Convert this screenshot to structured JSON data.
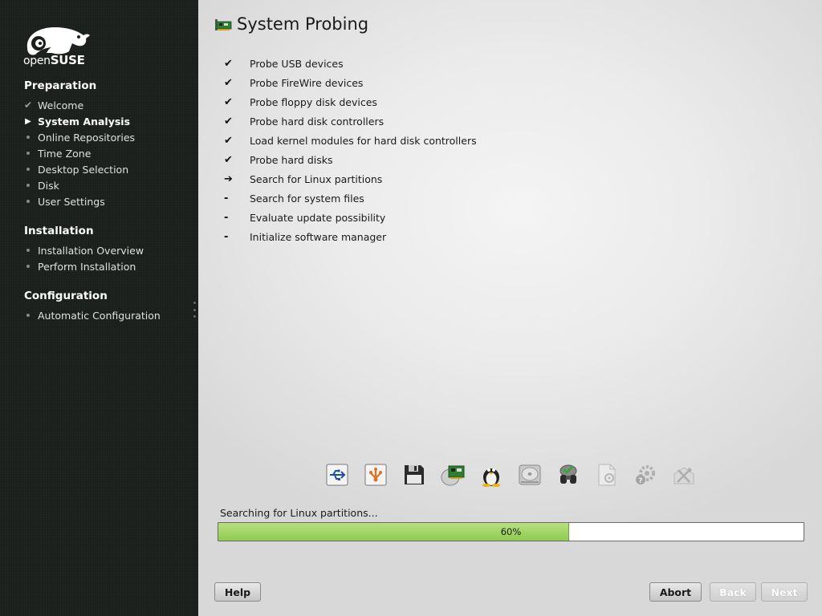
{
  "sidebar": {
    "logo_text_prefix": "open",
    "logo_text_brand": "SUSE",
    "sections": [
      {
        "title": "Preparation",
        "items": [
          {
            "label": "Welcome",
            "state": "done"
          },
          {
            "label": "System Analysis",
            "state": "current"
          },
          {
            "label": "Online Repositories",
            "state": "pending"
          },
          {
            "label": "Time Zone",
            "state": "pending"
          },
          {
            "label": "Desktop Selection",
            "state": "pending"
          },
          {
            "label": "Disk",
            "state": "pending"
          },
          {
            "label": "User Settings",
            "state": "pending"
          }
        ]
      },
      {
        "title": "Installation",
        "items": [
          {
            "label": "Installation Overview",
            "state": "pending"
          },
          {
            "label": "Perform Installation",
            "state": "pending"
          }
        ]
      },
      {
        "title": "Configuration",
        "items": [
          {
            "label": "Automatic Configuration",
            "state": "pending"
          }
        ]
      }
    ]
  },
  "main": {
    "title": "System Probing",
    "steps": [
      {
        "label": "Probe USB devices",
        "mark": "✔"
      },
      {
        "label": "Probe FireWire devices",
        "mark": "✔"
      },
      {
        "label": "Probe floppy disk devices",
        "mark": "✔"
      },
      {
        "label": "Probe hard disk controllers",
        "mark": "✔"
      },
      {
        "label": "Load kernel modules for hard disk controllers",
        "mark": "✔"
      },
      {
        "label": "Probe hard disks",
        "mark": "✔"
      },
      {
        "label": "Search for Linux partitions",
        "mark": "➔"
      },
      {
        "label": "Search for system files",
        "mark": "-"
      },
      {
        "label": "Evaluate update possibility",
        "mark": "-"
      },
      {
        "label": "Initialize software manager",
        "mark": "-"
      }
    ],
    "probe_icons": [
      {
        "name": "usb-icon",
        "active": true
      },
      {
        "name": "firewire-icon",
        "active": true
      },
      {
        "name": "floppy-disk-icon",
        "active": true
      },
      {
        "name": "disk-controller-icon",
        "active": true
      },
      {
        "name": "linux-tux-icon",
        "active": true
      },
      {
        "name": "hard-disk-icon",
        "active": true
      },
      {
        "name": "binoculars-icon",
        "active": true
      },
      {
        "name": "system-file-icon",
        "active": false
      },
      {
        "name": "update-gear-icon",
        "active": false
      },
      {
        "name": "software-tools-icon",
        "active": false
      }
    ],
    "status": "Searching for Linux partitions...",
    "progress": {
      "value": 60,
      "label": "60%"
    }
  },
  "buttons": {
    "help": "Help",
    "abort": "Abort",
    "back": "Back",
    "next": "Next"
  },
  "colors": {
    "sidebar_bg": "#1b1f1b",
    "progress_fill": "#8fcb52",
    "brand_green": "#73ba25"
  }
}
